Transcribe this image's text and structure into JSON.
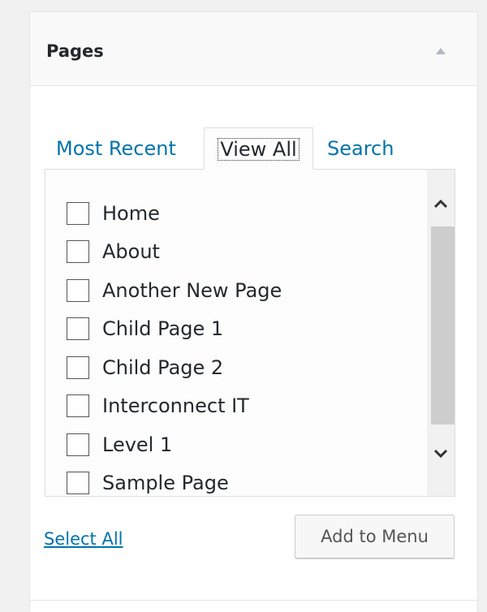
{
  "panel": {
    "title": "Pages",
    "collapse_icon": "arrow-up-icon"
  },
  "tabs": [
    {
      "label": "Most Recent",
      "active": false
    },
    {
      "label": "View All",
      "active": true
    },
    {
      "label": "Search",
      "active": false
    }
  ],
  "pages": [
    {
      "label": "Home",
      "checked": false
    },
    {
      "label": "About",
      "checked": false
    },
    {
      "label": "Another New Page",
      "checked": false
    },
    {
      "label": "Child Page 1",
      "checked": false
    },
    {
      "label": "Child Page 2",
      "checked": false
    },
    {
      "label": "Interconnect IT",
      "checked": false
    },
    {
      "label": "Level 1",
      "checked": false
    },
    {
      "label": "Sample Page",
      "checked": false
    }
  ],
  "footer": {
    "select_all_label": "Select All",
    "add_button_label": "Add to Menu"
  },
  "colors": {
    "link": "#0073aa",
    "text": "#23282d",
    "border": "#dddddd",
    "header_bg": "#f9f9f9"
  }
}
